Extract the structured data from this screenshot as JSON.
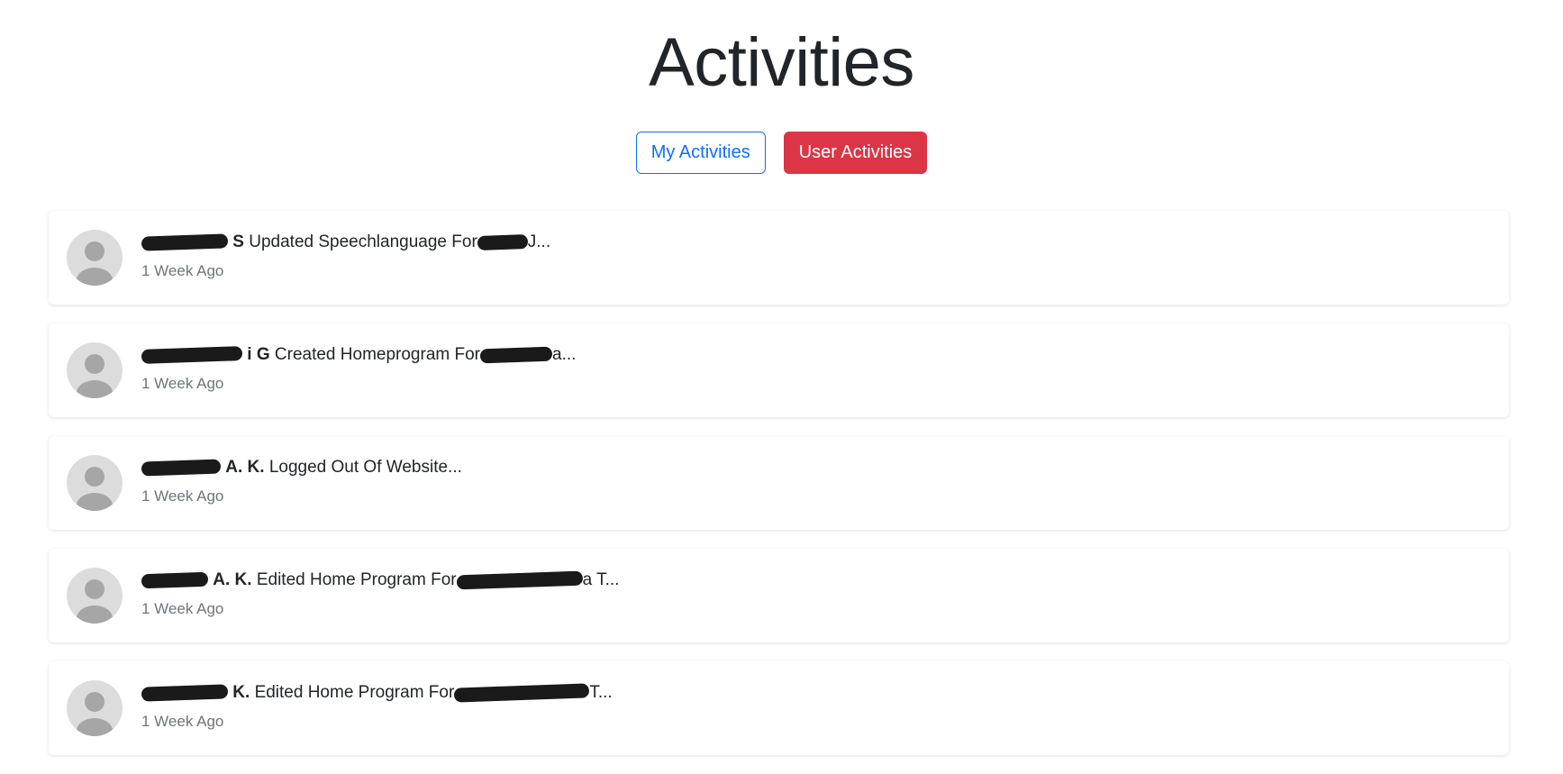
{
  "page": {
    "title": "Activities"
  },
  "toolbar": {
    "my_activities_label": "My Activities",
    "user_activities_label": "User Activities"
  },
  "colors": {
    "primary": "#0d6efd",
    "danger": "#dc3545",
    "avatar_bg": "#dcdcdc",
    "avatar_fg": "#a6a6a6",
    "muted": "#6c757d"
  },
  "activities": [
    {
      "name_suffix": "S",
      "action": "Updated Speechlanguage For",
      "target_suffix": "J...",
      "time": "1 Week Ago"
    },
    {
      "name_suffix": "i G",
      "action": "Created Homeprogram For",
      "target_suffix": "a...",
      "time": "1 Week Ago"
    },
    {
      "name_suffix": "A. K.",
      "action": "Logged Out Of Website...",
      "target_suffix": "",
      "time": "1 Week Ago"
    },
    {
      "name_suffix": "A. K.",
      "action": "Edited Home Program For",
      "target_suffix": "a T...",
      "time": "1 Week Ago"
    },
    {
      "name_suffix": "K.",
      "action": "Edited Home Program For",
      "target_suffix": "T...",
      "time": "1 Week Ago"
    }
  ]
}
